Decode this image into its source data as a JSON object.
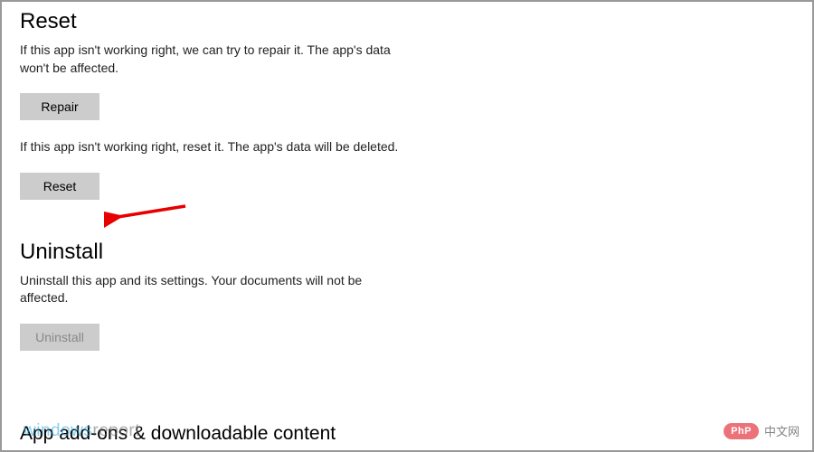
{
  "reset_section": {
    "heading": "Reset",
    "repair_description": "If this app isn't working right, we can try to repair it. The app's data won't be affected.",
    "repair_button": "Repair",
    "reset_description": "If this app isn't working right, reset it. The app's data will be deleted.",
    "reset_button": "Reset"
  },
  "uninstall_section": {
    "heading": "Uninstall",
    "description": "Uninstall this app and its settings. Your documents will not be affected.",
    "uninstall_button": "Uninstall"
  },
  "addons_section": {
    "heading": "App add-ons & downloadable content"
  },
  "watermarks": {
    "left_part1": "windows",
    "left_part2": "report",
    "right_pill": "PhP",
    "right_text": "中文网"
  }
}
